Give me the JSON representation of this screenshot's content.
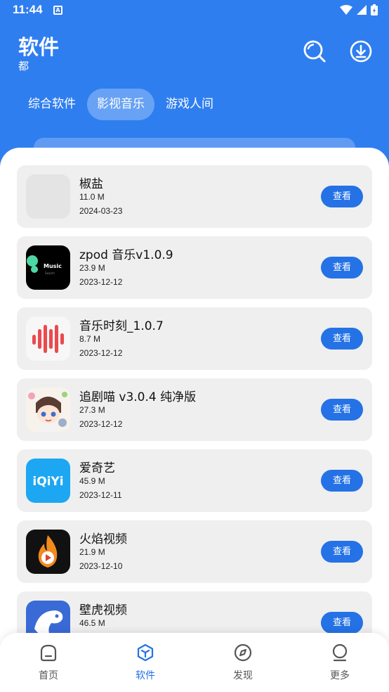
{
  "status_bar": {
    "time": "11:44",
    "a_badge": "A"
  },
  "header": {
    "title": "软件",
    "subtitle": "都"
  },
  "tabs": [
    {
      "label": "综合软件",
      "active": false
    },
    {
      "label": "影视音乐",
      "active": true
    },
    {
      "label": "游戏人间",
      "active": false
    }
  ],
  "apps": [
    {
      "name": "椒盐",
      "size": "11.0 M",
      "date": "2024-03-23",
      "button": "查看",
      "icon": "blank-app-icon"
    },
    {
      "name": "zpod 音乐v1.0.9",
      "size": "23.9 M",
      "date": "2023-12-12",
      "button": "查看",
      "icon": "music-search-icon",
      "icon_text": "Music",
      "icon_subtext": "Search"
    },
    {
      "name": "音乐时刻_1.0.7",
      "size": "8.7 M",
      "date": "2023-12-12",
      "button": "查看",
      "icon": "sound-wave-icon"
    },
    {
      "name": "追剧喵 v3.0.4 纯净版",
      "size": "27.3 M",
      "date": "2023-12-12",
      "button": "查看",
      "icon": "anime-character-icon"
    },
    {
      "name": "爱奇艺",
      "size": "45.9 M",
      "date": "2023-12-11",
      "button": "查看",
      "icon": "iqiyi-logo-icon",
      "icon_text": "iQiYi"
    },
    {
      "name": "火焰视频",
      "size": "21.9 M",
      "date": "2023-12-10",
      "button": "查看",
      "icon": "flame-play-icon"
    },
    {
      "name": "壁虎视频",
      "size": "46.5 M",
      "date": "",
      "button": "查看",
      "icon": "gecko-icon"
    }
  ],
  "bottom_nav": [
    {
      "label": "首页",
      "icon": "home-icon",
      "active": false
    },
    {
      "label": "软件",
      "icon": "cube-icon",
      "active": true
    },
    {
      "label": "发现",
      "icon": "compass-icon",
      "active": false
    },
    {
      "label": "更多",
      "icon": "person-icon",
      "active": false
    }
  ],
  "colors": {
    "primary": "#2f7ef0",
    "button": "#2472e6",
    "card": "#efefef"
  }
}
